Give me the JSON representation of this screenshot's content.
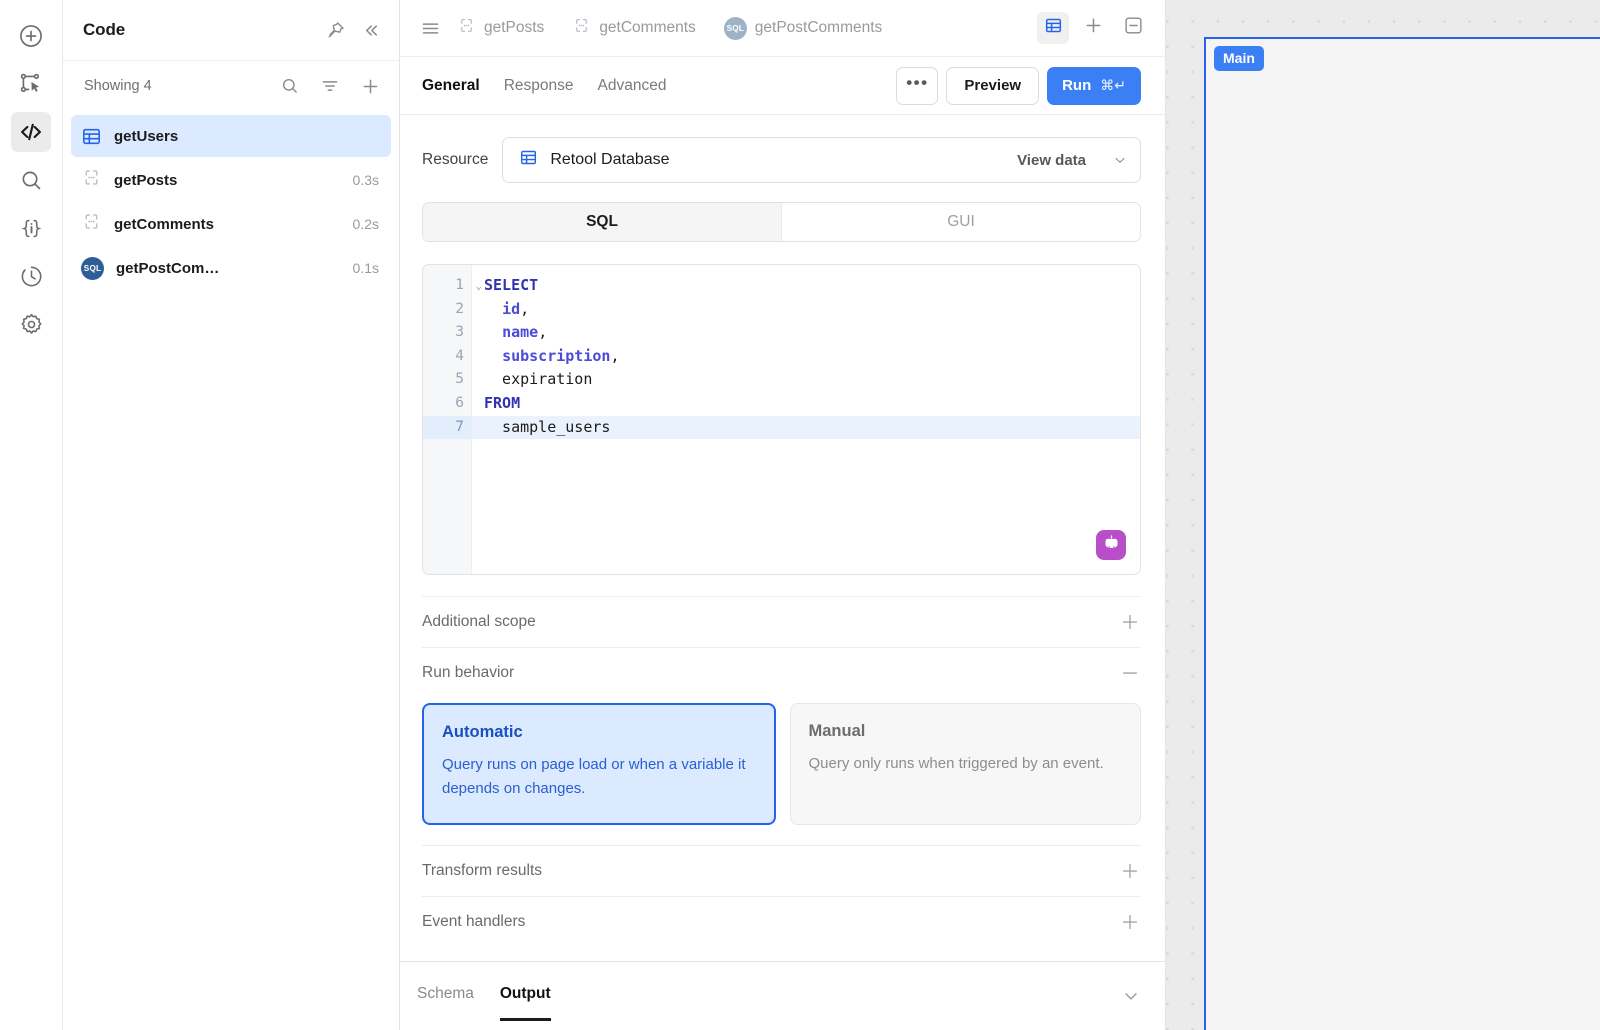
{
  "rail": {
    "items": [
      {
        "name": "add-component",
        "icon": "plus-circle-icon",
        "active": false
      },
      {
        "name": "select-component",
        "icon": "component-select-icon",
        "active": false
      },
      {
        "name": "code",
        "icon": "code-brackets-icon",
        "active": true
      },
      {
        "name": "search",
        "icon": "search-icon",
        "active": false
      },
      {
        "name": "state",
        "icon": "state-braces-icon",
        "active": false
      },
      {
        "name": "history",
        "icon": "history-clock-icon",
        "active": false
      },
      {
        "name": "settings",
        "icon": "gear-icon",
        "active": false
      }
    ]
  },
  "panel": {
    "title": "Code",
    "pin_icon": "pin-icon",
    "collapse_icon": "chevrons-left-icon",
    "showing_label": "Showing 4",
    "search_icon": "search-icon",
    "filter_icon": "filter-icon",
    "add_icon": "plus-icon",
    "queries": [
      {
        "name": "getUsers",
        "icon": "table-icon",
        "time": "",
        "selected": true
      },
      {
        "name": "getPosts",
        "icon": "braces-icon",
        "time": "0.3s",
        "selected": false
      },
      {
        "name": "getComments",
        "icon": "braces-icon",
        "time": "0.2s",
        "selected": false
      },
      {
        "name": "getPostCom…",
        "icon": "sql-icon",
        "time": "0.1s",
        "selected": false
      }
    ]
  },
  "tabbar": {
    "menu_icon": "hamburger-icon",
    "tabs": [
      {
        "label": "getPosts",
        "icon": "braces-icon",
        "active": false
      },
      {
        "label": "getComments",
        "icon": "braces-icon",
        "active": false
      },
      {
        "label": "getPostComments",
        "icon": "sql-icon",
        "active": false
      }
    ],
    "table_view_icon": "table-icon",
    "add_icon": "plus-icon",
    "collapse_icon": "minus-box-icon"
  },
  "subbar": {
    "tabs": [
      {
        "label": "General",
        "active": true
      },
      {
        "label": "Response",
        "active": false
      },
      {
        "label": "Advanced",
        "active": false
      }
    ],
    "more_label": "•••",
    "preview_label": "Preview",
    "run_label": "Run",
    "run_shortcut": "⌘↵"
  },
  "general": {
    "resource_label": "Resource",
    "resource_value": "Retool Database",
    "resource_icon": "table-icon",
    "view_data_label": "View data",
    "dropdown_icon": "chevron-down-icon",
    "mode_tabs": [
      {
        "label": "SQL",
        "active": true
      },
      {
        "label": "GUI",
        "active": false
      }
    ],
    "editor": {
      "ai_icon": "robot-icon",
      "active_line": 7,
      "lines": [
        {
          "n": "1",
          "fold": "⌄",
          "tokens": [
            {
              "t": "SELECT",
              "c": "kw"
            }
          ]
        },
        {
          "n": "2",
          "fold": "",
          "tokens": [
            {
              "t": "  ",
              "c": "punc"
            },
            {
              "t": "id",
              "c": "col"
            },
            {
              "t": ",",
              "c": "punc"
            }
          ]
        },
        {
          "n": "3",
          "fold": "",
          "tokens": [
            {
              "t": "  ",
              "c": "punc"
            },
            {
              "t": "name",
              "c": "col"
            },
            {
              "t": ",",
              "c": "punc"
            }
          ]
        },
        {
          "n": "4",
          "fold": "",
          "tokens": [
            {
              "t": "  ",
              "c": "punc"
            },
            {
              "t": "subscription",
              "c": "col"
            },
            {
              "t": ",",
              "c": "punc"
            }
          ]
        },
        {
          "n": "5",
          "fold": "",
          "tokens": [
            {
              "t": "  expiration",
              "c": "punc"
            }
          ]
        },
        {
          "n": "6",
          "fold": "",
          "tokens": [
            {
              "t": "FROM",
              "c": "kw"
            }
          ]
        },
        {
          "n": "7",
          "fold": "",
          "tokens": [
            {
              "t": "  sample_users",
              "c": "punc"
            }
          ]
        }
      ]
    },
    "sections": [
      {
        "label": "Additional scope",
        "control": "+"
      },
      {
        "label": "Run behavior",
        "control": "−"
      }
    ],
    "run_behavior": [
      {
        "title": "Automatic",
        "desc": "Query runs on page load or when a variable it depends on changes.",
        "active": true
      },
      {
        "title": "Manual",
        "desc": "Query only runs when triggered by an event.",
        "active": false
      }
    ],
    "sections_bottom": [
      {
        "label": "Transform results",
        "control": "+"
      },
      {
        "label": "Event handlers",
        "control": "+"
      }
    ]
  },
  "bottom": {
    "tabs": [
      {
        "label": "Schema",
        "active": false
      },
      {
        "label": "Output",
        "active": true
      }
    ],
    "expand_icon": "chevron-down-icon"
  },
  "canvas": {
    "frame_label": "Main"
  },
  "colors": {
    "accent_blue": "#3b7ff5",
    "selection_blue": "#dbeafe",
    "border_blue": "#2563eb",
    "ai_purple": "#b94fc8",
    "sql_badge": "#2d5f96",
    "canvas_bg": "#ebebeb",
    "frame_bg": "#f5f5f5"
  }
}
